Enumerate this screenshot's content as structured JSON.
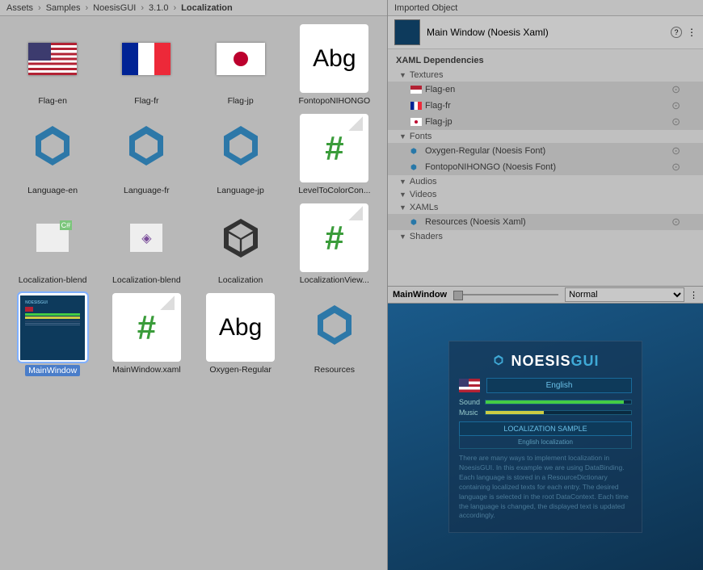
{
  "breadcrumb": [
    "Assets",
    "Samples",
    "NoesisGUI",
    "3.1.0",
    "Localization"
  ],
  "assets": [
    {
      "name": "Flag-en",
      "type": "flag-us"
    },
    {
      "name": "Flag-fr",
      "type": "flag-fr"
    },
    {
      "name": "Flag-jp",
      "type": "flag-jp"
    },
    {
      "name": "FontopoNIHONGO",
      "type": "font"
    },
    {
      "name": "Language-en",
      "type": "noesis"
    },
    {
      "name": "Language-fr",
      "type": "noesis"
    },
    {
      "name": "Language-jp",
      "type": "noesis"
    },
    {
      "name": "LevelToColorCon...",
      "type": "code"
    },
    {
      "name": "Localization-blend",
      "type": "blend1"
    },
    {
      "name": "Localization-blend",
      "type": "blend2"
    },
    {
      "name": "Localization",
      "type": "unity"
    },
    {
      "name": "LocalizationView...",
      "type": "code"
    },
    {
      "name": "MainWindow",
      "type": "mainwindow",
      "selected": true
    },
    {
      "name": "MainWindow.xaml",
      "type": "code"
    },
    {
      "name": "Oxygen-Regular",
      "type": "font"
    },
    {
      "name": "Resources",
      "type": "noesis"
    }
  ],
  "inspector": {
    "header": "Imported Object",
    "title": "Main Window (Noesis Xaml)",
    "deps_title": "XAML Dependencies",
    "groups": {
      "textures": "Textures",
      "fonts": "Fonts",
      "audios": "Audios",
      "videos": "Videos",
      "xamls": "XAMLs",
      "shaders": "Shaders"
    },
    "textures": [
      "Flag-en",
      "Flag-fr",
      "Flag-jp"
    ],
    "fonts": [
      "Oxygen-Regular (Noesis Font)",
      "FontopoNIHONGO (Noesis Font)"
    ],
    "xamls": [
      "Resources (Noesis Xaml)"
    ]
  },
  "preview_bar": {
    "label": "MainWindow",
    "mode": "Normal"
  },
  "preview": {
    "logo_a": "NOESIS",
    "logo_b": "GUI",
    "lang": "English",
    "sound": "Sound",
    "music": "Music",
    "title": "LOCALIZATION SAMPLE",
    "subtitle": "English localization",
    "desc": "There are many ways to implement localization in NoesisGUI. In this example we are using DataBinding. Each language is stored in a ResourceDictionary containing localized texts for each entry. The desired language is selected in the root DataContext. Each time the language is changed, the displayed text is updated accordingly."
  }
}
